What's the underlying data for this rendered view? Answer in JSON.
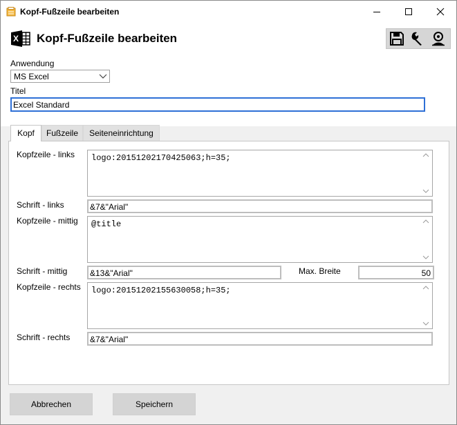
{
  "window": {
    "title": "Kopf-Fußzeile bearbeiten"
  },
  "header": {
    "title": "Kopf-Fußzeile bearbeiten"
  },
  "toolbar": {
    "icons": [
      "save-icon",
      "wrench-icon",
      "user-icon"
    ]
  },
  "form": {
    "anwendung_label": "Anwendung",
    "anwendung_value": "MS Excel",
    "titel_label": "Titel",
    "titel_value": "Excel Standard"
  },
  "tabs": [
    {
      "label": "Kopf",
      "active": true
    },
    {
      "label": "Fußzeile",
      "active": false
    },
    {
      "label": "Seiteneinrichtung",
      "active": false
    }
  ],
  "kopf": {
    "links_label": "Kopfzeile - links",
    "links_value": "logo:20151202170425063;h=35;",
    "schrift_links_label": "Schrift - links",
    "schrift_links_value": "&7&\"Arial\"",
    "mittig_label": "Kopfzeile - mittig",
    "mittig_value": "@title",
    "schrift_mittig_label": "Schrift - mittig",
    "schrift_mittig_value": "&13&\"Arial\"",
    "max_breite_label": "Max. Breite",
    "max_breite_value": "50",
    "rechts_label": "Kopfzeile - rechts",
    "rechts_value": "logo:20151202155630058;h=35;",
    "schrift_rechts_label": "Schrift - rechts",
    "schrift_rechts_value": "&7&\"Arial\""
  },
  "buttons": {
    "cancel": "Abbrechen",
    "save": "Speichern"
  }
}
